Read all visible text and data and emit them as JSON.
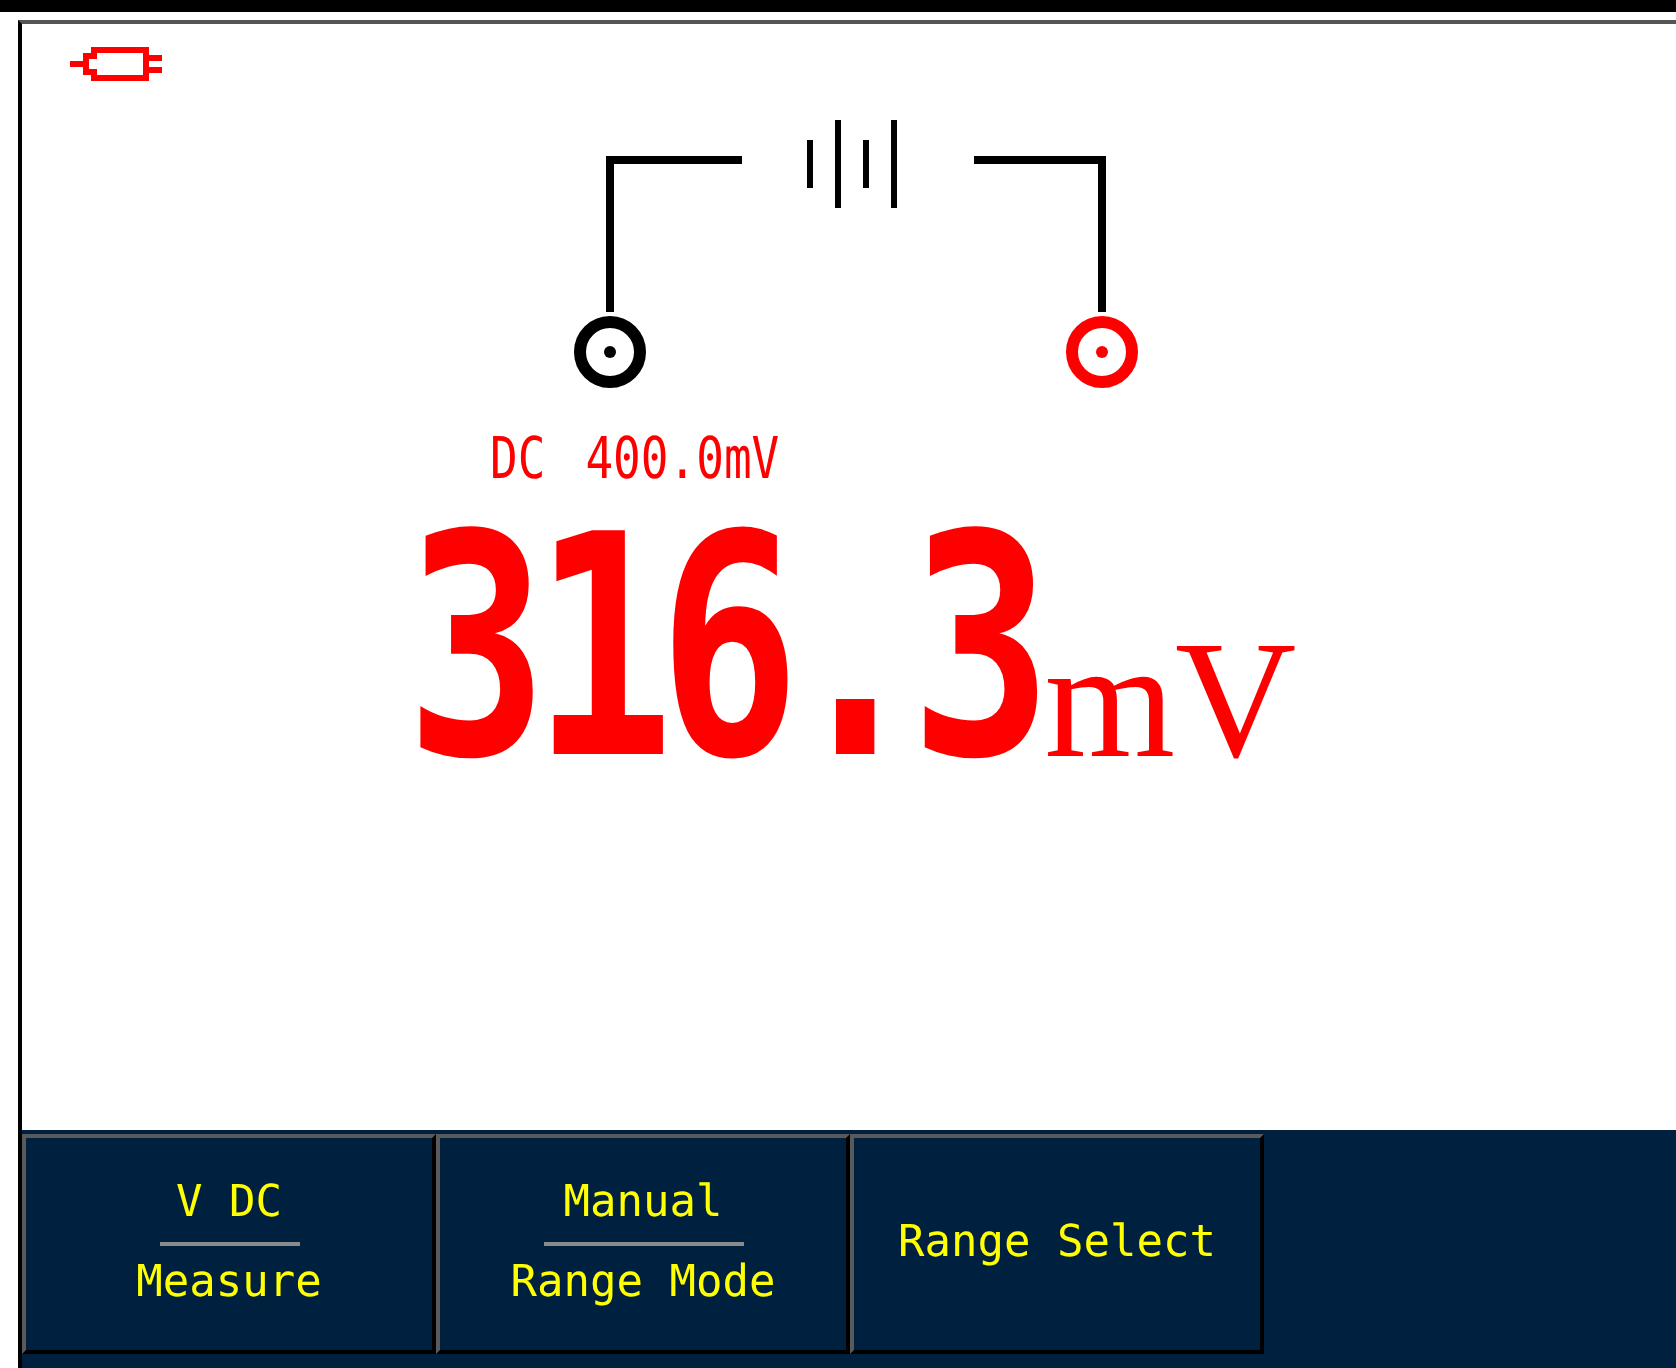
{
  "diagram": {
    "terminals": [
      {
        "color": "#000000"
      },
      {
        "color": "#ff0000"
      }
    ]
  },
  "measurement": {
    "coupling": "DC",
    "range": "400.0mV",
    "reading": "316.3",
    "unit": "mV"
  },
  "softkeys": [
    {
      "kind": "split",
      "value": "V DC",
      "label": "Measure"
    },
    {
      "kind": "split",
      "value": "Manual",
      "label": "Range Mode"
    },
    {
      "kind": "single",
      "label": "Range Select"
    }
  ]
}
